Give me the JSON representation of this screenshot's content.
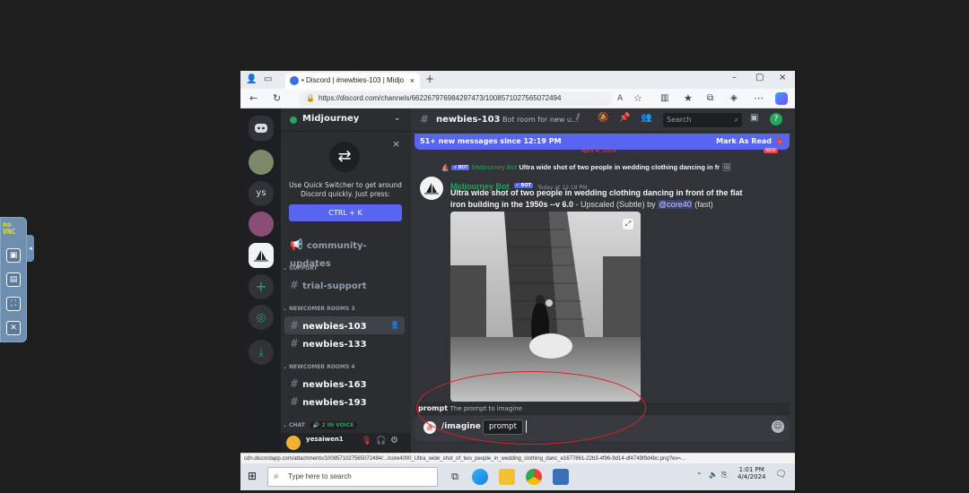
{
  "novnc": {
    "logo": "no\nVNC",
    "buttons": [
      "keyboard-icon",
      "clipboard-icon",
      "fullscreen-icon",
      "disconnect-icon"
    ]
  },
  "browser": {
    "tab_title": "• Discord | #newbies-103 | Midjo",
    "tab_close": "×",
    "new_tab": "+",
    "url": "https://discord.com/channels/662267976984297473/1008571027565072494",
    "window_controls": [
      "–",
      "▢",
      "×"
    ]
  },
  "discord": {
    "server_name": "Midjourney",
    "servers": [
      "discord-home-icon",
      "server-1",
      "ys",
      "server-3",
      "midjourney-server",
      "add-server-icon",
      "explore-icon",
      "download-icon"
    ],
    "quick_switcher": {
      "text": "Use Quick Switcher to get around Discord quickly. Just press:",
      "button": "CTRL + K",
      "close": "×"
    },
    "channels": {
      "community_updates": "community-updates",
      "cat_support": "SUPPORT",
      "trial_support": "trial-support",
      "cat_newcomer3": "NEWCOMER ROOMS 3",
      "newbies_103": "newbies-103",
      "newbies_133": "newbies-133",
      "cat_newcomer4": "NEWCOMER ROOMS 4",
      "newbies_163": "newbies-163",
      "newbies_193": "newbies-193",
      "cat_chat": "CHAT",
      "voice_badge": "2 IN VOICE",
      "user": "yesaiwen1"
    },
    "header": {
      "channel": "newbies-103",
      "topic": "Bot room for new u...",
      "search_placeholder": "Search"
    },
    "new_messages_bar": {
      "text": "51+ new messages since 12:19 PM",
      "action": "Mark As Read"
    },
    "date_divider": "April 4, 2024",
    "new_badge": "NEW",
    "message": {
      "reply_badge": "✓ BOT",
      "reply_author": "Midjourney Bot",
      "reply_text": "Ultra wide shot of two people in wedding clothing dancing in fr",
      "author": "Midjourney Bot",
      "bot_badge": "✓ BOT",
      "timestamp": "Today at 12:19 PM",
      "prompt": "Ultra wide shot of two people in wedding clothing dancing in front of the flat iron building in the 1950s --v 6.0",
      "suffix": " - Upscaled (Subtle) by ",
      "mention": "@core40",
      "speed": " (fast)"
    },
    "command_hint": {
      "option": "prompt",
      "description": "The prompt to imagine"
    },
    "input": {
      "command": "/imagine",
      "param": "prompt"
    }
  },
  "status_url": "cdn.discordapp.com/attachments/1008571027565072494/.../core4000_Ultra_wide_shot_of_two_people_in_wedding_clothing_danc_e1677861-22b3-4f96-9d14-df4749f9d4bc.png?ex=...",
  "taskbar": {
    "search_placeholder": "Type here to search",
    "time": "1:01 PM",
    "date": "4/4/2024"
  }
}
